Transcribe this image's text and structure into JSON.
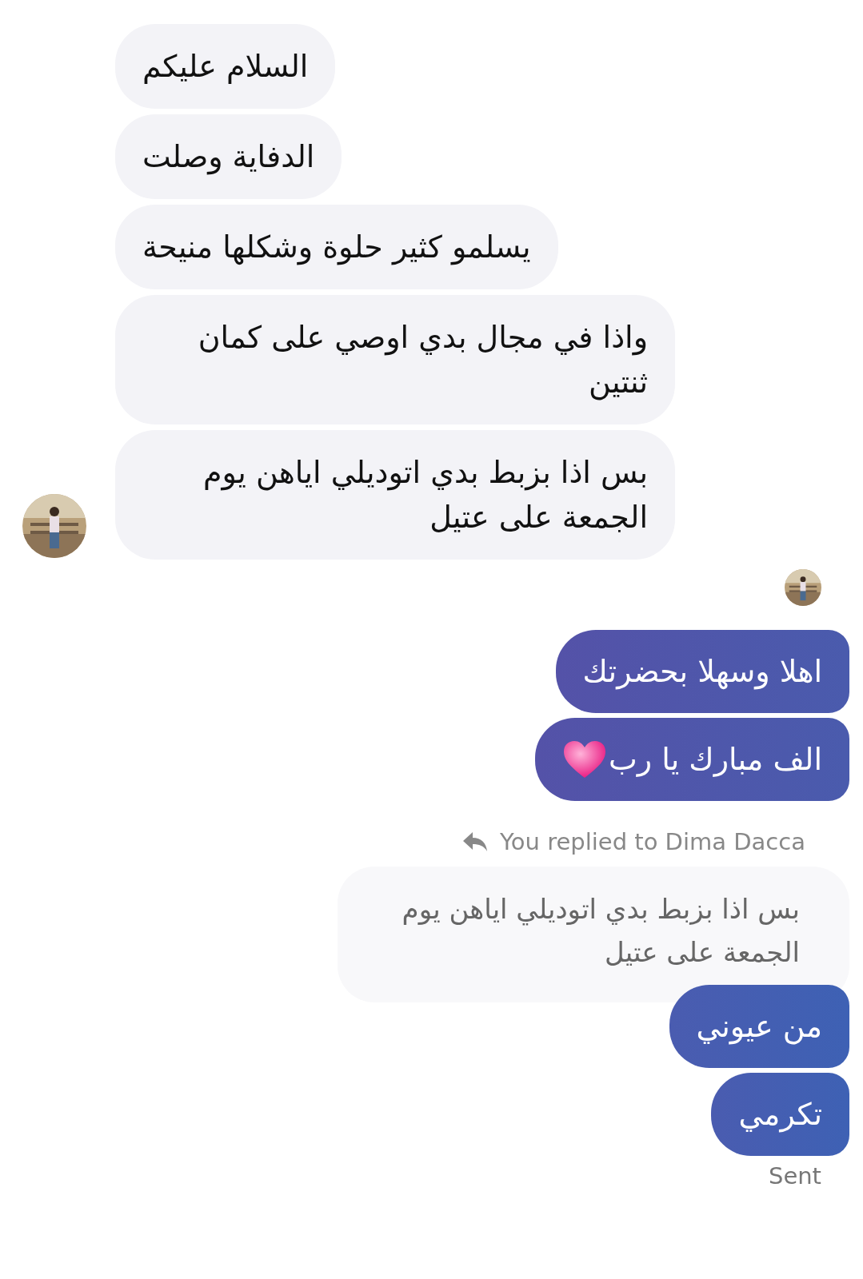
{
  "incoming": [
    {
      "text": "السلام عليكم"
    },
    {
      "text": "الدفاية وصلت"
    },
    {
      "text": "يسلمو كثير حلوة وشكلها منيحة"
    },
    {
      "text": "واذا  في مجال بدي اوصي على كمان ثنتين"
    },
    {
      "text": "بس اذا بزبط بدي اتوديلي اياهن يوم الجمعة على عتيل"
    }
  ],
  "outgoing": [
    {
      "text": "اهلا وسهلا بحضرتك",
      "kind": "text"
    },
    {
      "text": "الف مبارك يا رب",
      "kind": "heart"
    }
  ],
  "reply": {
    "label": "You replied to Dima Dacca",
    "quoted": "بس اذا بزبط بدي اتوديلي اياهن يوم الجمعة على عتيل"
  },
  "outgoing_after": [
    {
      "text": "من عيوني",
      "kind": "text"
    },
    {
      "text": "تكرمي",
      "kind": "text"
    }
  ],
  "status": "Sent"
}
